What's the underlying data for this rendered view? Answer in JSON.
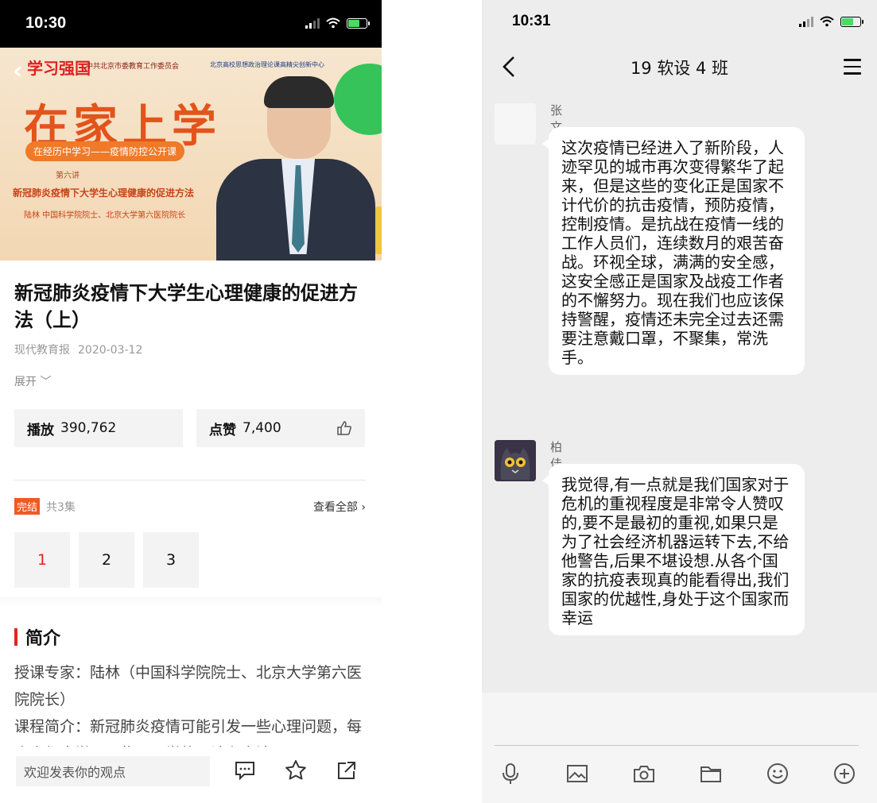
{
  "left": {
    "status": {
      "time": "10:30"
    },
    "banner": {
      "logo": "学习强国",
      "org1": "中共北京市委教育工作委员会",
      "org2": "北京高校思想政治理论课高精尖创新中心",
      "big_title": "在家上学",
      "pill": "在经历中学习——疫情防控公开课",
      "lecture": "第六讲",
      "subtitle": "新冠肺炎疫情下大学生心理健康的促进方法",
      "speaker": "陆林 中国科学院院士、北京大学第六医院院长"
    },
    "article": {
      "title": "新冠肺炎疫情下大学生心理健康的促进方法（上）",
      "source": "现代教育报",
      "date": "2020-03-12",
      "expand": "展开"
    },
    "stats": {
      "play_label": "播放",
      "play_value": "390,762",
      "like_label": "点赞",
      "like_value": "7,400"
    },
    "episodes": {
      "tag": "完结",
      "count": "共3集",
      "see_all": "查看全部",
      "items": [
        "1",
        "2",
        "3"
      ]
    },
    "intro": {
      "heading": "简介",
      "line1": "授课专家：陆林（中国科学院院士、北京大学第六医院院长）",
      "line2": "课程简介：新冠肺炎疫情可能引发一些心理问题，每个人都应学习一些心理学的理论和方法"
    },
    "bottom": {
      "comment_placeholder": "欢迎发表你的观点"
    }
  },
  "right": {
    "status": {
      "time": "10:31"
    },
    "nav": {
      "title": "19 软设 4 班"
    },
    "messages": [
      {
        "name": "张文宇",
        "text": "这次疫情已经进入了新阶段，人迹罕见的城市再次变得繁华了起来，但是这些的变化正是国家不计代价的抗击疫情，预防疫情，控制疫情。是抗战在疫情一线的工作人员们，连续数月的艰苦奋战。环视全球，满满的安全感，这安全感正是国家及战疫工作者的不懈努力。现在我们也应该保持警醒，疫情还未完全过去还需要注意戴口罩，不聚集，常洗手。"
      },
      {
        "name": "柏佳辰",
        "text": "我觉得,有一点就是我们国家对于危机的重视程度是非常令人赞叹的,要不是最初的重视,如果只是为了社会经济机器运转下去,不给他警告,后果不堪设想.从各个国家的抗疫表现真的能看得出,我们国家的优越性,身处于这个国家而幸运"
      }
    ]
  }
}
